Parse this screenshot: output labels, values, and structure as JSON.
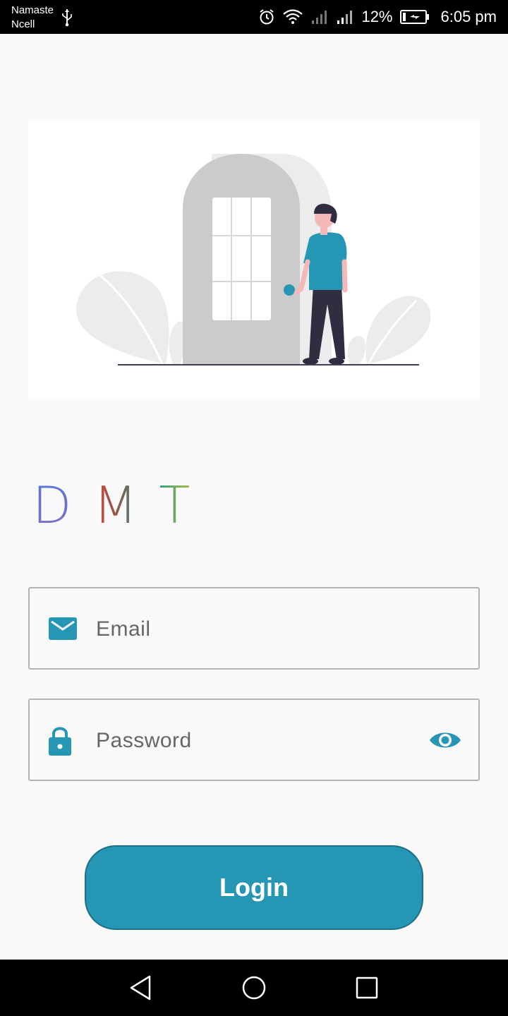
{
  "status_bar": {
    "carrier_line1": "Namaste",
    "carrier_line2": "Ncell",
    "battery": "12%",
    "time": "6:05 pm",
    "icons": [
      "usb-icon",
      "alarm-icon",
      "wifi-icon",
      "signal-icon",
      "signal-icon",
      "battery-charging-icon"
    ]
  },
  "brand": {
    "letters": [
      "D",
      "M",
      "T"
    ],
    "colors": [
      "#5b6ed1",
      "#c9413c",
      "#2a9a79"
    ]
  },
  "email": {
    "placeholder": "Email",
    "icon": "mail-icon"
  },
  "password": {
    "placeholder": "Password",
    "icon": "lock-icon",
    "toggle_icon": "eye-icon"
  },
  "login": {
    "label": "Login"
  },
  "colors": {
    "accent": "#2596b4",
    "background": "#f9f9f9"
  },
  "nav": {
    "icons": [
      "back-icon",
      "home-icon",
      "recents-icon"
    ]
  }
}
